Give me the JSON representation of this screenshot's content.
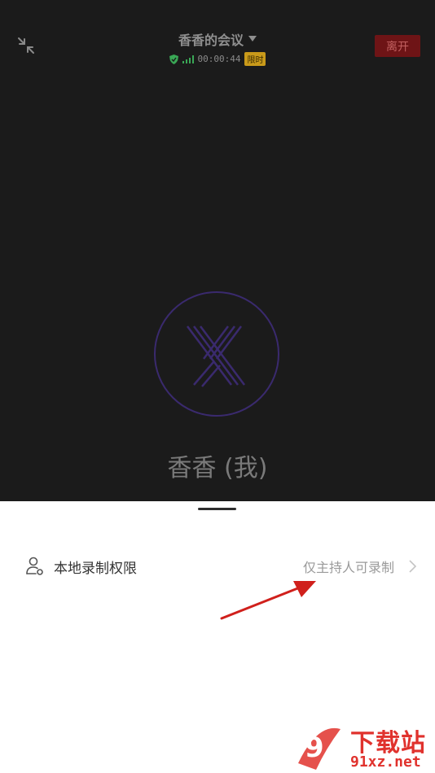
{
  "header": {
    "title": "香香的会议",
    "duration": "00:00:44",
    "badge": "限时",
    "leave_label": "离开"
  },
  "participant": {
    "name": "香香 (我)"
  },
  "panel": {
    "setting_label": "本地录制权限",
    "setting_value": "仅主持人可录制"
  },
  "watermark": {
    "brand": "下载站",
    "domain": "91xz.net",
    "logo_text": "9"
  },
  "colors": {
    "background": "#1b1b1b",
    "leave_button": "#6e1416",
    "avatar_ring": "#3a2a6e",
    "shield": "#3aa856",
    "signal": "#3aa856",
    "badge": "#c99a1a",
    "annotation_arrow": "#d0201c",
    "watermark": "#e0322d"
  },
  "icons": [
    "minimize-icon",
    "dropdown-triangle-icon",
    "shield-icon",
    "signal-icon",
    "user-record-icon",
    "chevron-right-icon"
  ]
}
